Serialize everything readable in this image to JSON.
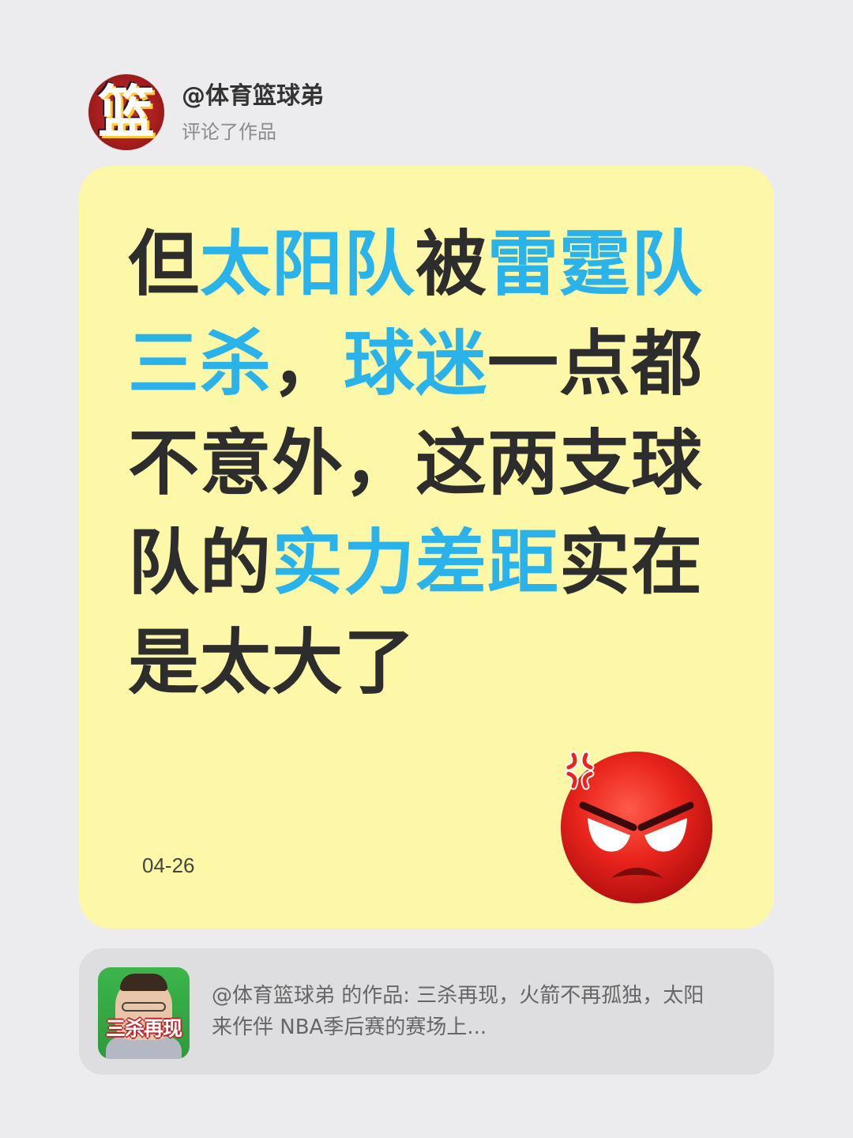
{
  "header": {
    "username": "@体育篮球弟",
    "action": "评论了作品",
    "avatar_glyph": "篮"
  },
  "comment": {
    "segments": [
      {
        "text": "但",
        "highlight": false
      },
      {
        "text": "太阳队",
        "highlight": true
      },
      {
        "text": "被",
        "highlight": false
      },
      {
        "text": "雷霆队三杀",
        "highlight": true
      },
      {
        "text": "，",
        "highlight": false
      },
      {
        "text": "球迷",
        "highlight": true
      },
      {
        "text": "一点都不意外，这两支球队的",
        "highlight": false
      },
      {
        "text": "实力差距",
        "highlight": true
      },
      {
        "text": "实在是太大了",
        "highlight": false
      }
    ],
    "date": "04-26",
    "emoji": "angry-face-icon"
  },
  "linked_post": {
    "thumbnail_caption": "三杀再现",
    "text": "@体育篮球弟 的作品: 三杀再现，火箭不再孤独，太阳来作伴 NBA季后赛的赛场上..."
  },
  "colors": {
    "background": "#ececef",
    "card": "#fdf8a8",
    "highlight": "#29b3ea",
    "text": "#2d2d2d",
    "linked_card": "#dedee0"
  }
}
